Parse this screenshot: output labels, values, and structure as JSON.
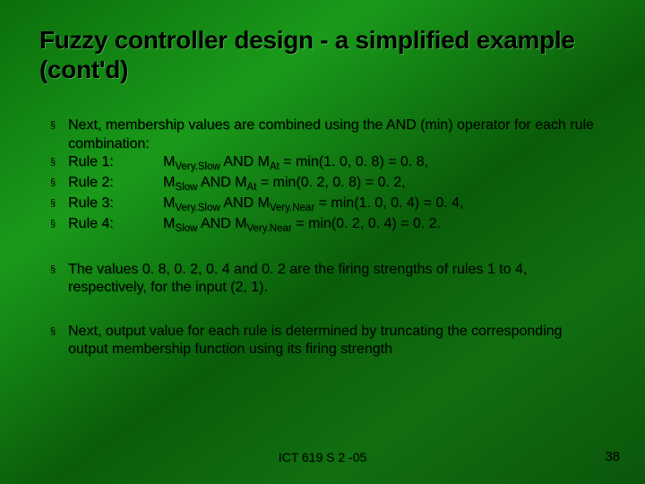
{
  "title": "Fuzzy controller design - a simplified example (cont'd)",
  "intro": "Next, membership values are combined using the AND (min) operator for each rule combination:",
  "rules": {
    "r1": {
      "label": "Rule 1:",
      "m1sub": "Very.Slow",
      "m2sub": "At",
      "expr": "  =  min(1. 0, 0. 8)  =  0. 8,"
    },
    "r2": {
      "label": "Rule 2:",
      "m1sub": "Slow",
      "m2sub": "At",
      "expr": "  =  min(0. 2, 0. 8)  =  0. 2,"
    },
    "r3": {
      "label": "Rule 3:",
      "m1sub": "Very.Slow",
      "m2sub": "Very.Near",
      "expr": "   =  min(1. 0, 0. 4)  =  0. 4,"
    },
    "r4": {
      "label": "Rule 4:",
      "m1sub": "Slow",
      "m2sub": "Very.Near",
      "expr": "   =  min(0. 2, 0. 4)  =  0. 2."
    }
  },
  "para2": "The values 0. 8, 0. 2, 0. 4 and 0. 2 are the firing strengths of rules 1 to 4, respectively, for the input (2, 1).",
  "para3": "Next, output value for each rule is determined by truncating the corresponding output membership function using its firing strength",
  "footer": {
    "center": "ICT 619 S 2 -05",
    "page": "38"
  },
  "glyph": {
    "bullet": "§",
    "and": " AND "
  }
}
